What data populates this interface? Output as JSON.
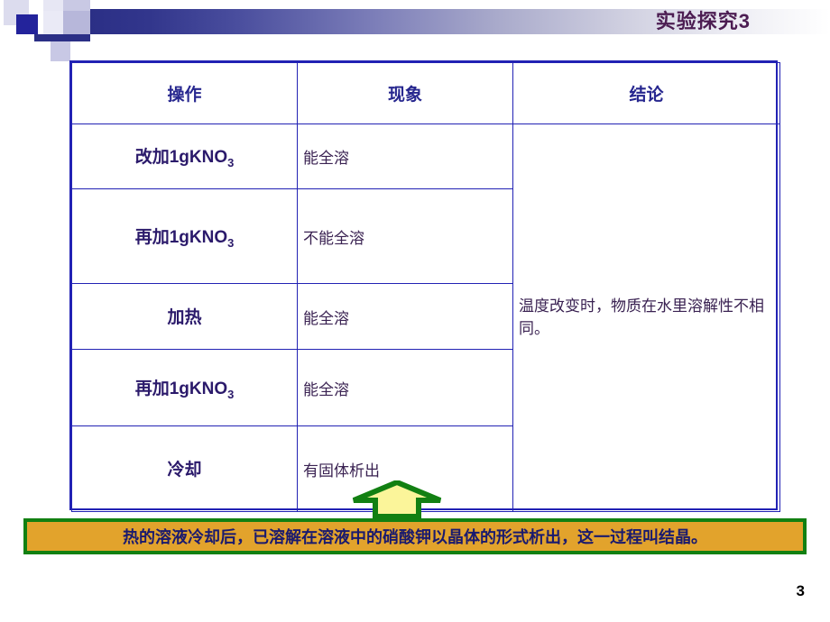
{
  "slide": {
    "title": "实验探究3",
    "page_number": "3",
    "title_color": "#4c1d52",
    "band_start_color": "#2b2f86",
    "band_end_color": "#ffffff"
  },
  "table": {
    "border_color": "#2222b4",
    "headers": [
      "操作",
      "现象",
      "结论"
    ],
    "rows": [
      {
        "operation": "改加1gKNO",
        "operation_sub": "3",
        "phenomenon": "能全溶"
      },
      {
        "operation": "再加1gKNO",
        "operation_sub": "3",
        "phenomenon": "不能全溶"
      },
      {
        "operation": "加热",
        "operation_sub": "",
        "phenomenon": "能全溶"
      },
      {
        "operation": "再加1gKNO",
        "operation_sub": "3",
        "phenomenon": "能全溶"
      },
      {
        "operation": "冷却",
        "operation_sub": "",
        "phenomenon": "有固体析出"
      }
    ],
    "conclusion": "温度改变时，物质在水里溶解性不相同。"
  },
  "arrow": {
    "fill_color": "#FBF59A",
    "stroke_color": "#128012"
  },
  "callout": {
    "text": "热的溶液冷却后，已溶解在溶液中的硝酸钾以晶体的形式析出，这一过程叫结晶。",
    "background_color": "#e2a32c",
    "border_color": "#128012",
    "text_color": "#1a1a6e"
  }
}
